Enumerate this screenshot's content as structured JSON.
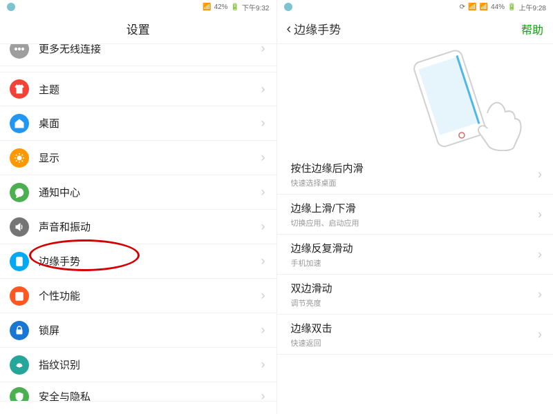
{
  "left": {
    "status": {
      "battery": "42%",
      "time": "下午9:32"
    },
    "title": "设置",
    "items": [
      {
        "label": "更多无线连接",
        "color": "ic-gray",
        "icon": "dots"
      },
      {
        "label": "主题",
        "color": "ic-red",
        "icon": "shirt"
      },
      {
        "label": "桌面",
        "color": "ic-blue",
        "icon": "home"
      },
      {
        "label": "显示",
        "color": "ic-orange",
        "icon": "sun"
      },
      {
        "label": "通知中心",
        "color": "ic-green",
        "icon": "chat"
      },
      {
        "label": "声音和振动",
        "color": "ic-dgray",
        "icon": "speaker"
      },
      {
        "label": "边缘手势",
        "color": "ic-lblue",
        "icon": "phone"
      },
      {
        "label": "个性功能",
        "color": "ic-dorange",
        "icon": "star"
      },
      {
        "label": "锁屏",
        "color": "ic-dblue",
        "icon": "lock"
      },
      {
        "label": "指纹识别",
        "color": "ic-teal",
        "icon": "finger"
      },
      {
        "label": "安全与隐私",
        "color": "ic-green",
        "icon": "shield"
      }
    ]
  },
  "right": {
    "status": {
      "battery": "44%",
      "time": "上午9:28"
    },
    "back_label": "边缘手势",
    "action": "帮助",
    "rows": [
      {
        "title": "按住边缘后内滑",
        "sub": "快速选择桌面"
      },
      {
        "title": "边缘上滑/下滑",
        "sub": "切换应用、启动应用"
      },
      {
        "title": "边缘反复滑动",
        "sub": "手机加速"
      },
      {
        "title": "双边滑动",
        "sub": "调节亮度"
      },
      {
        "title": "边缘双击",
        "sub": "快速返回"
      }
    ]
  }
}
